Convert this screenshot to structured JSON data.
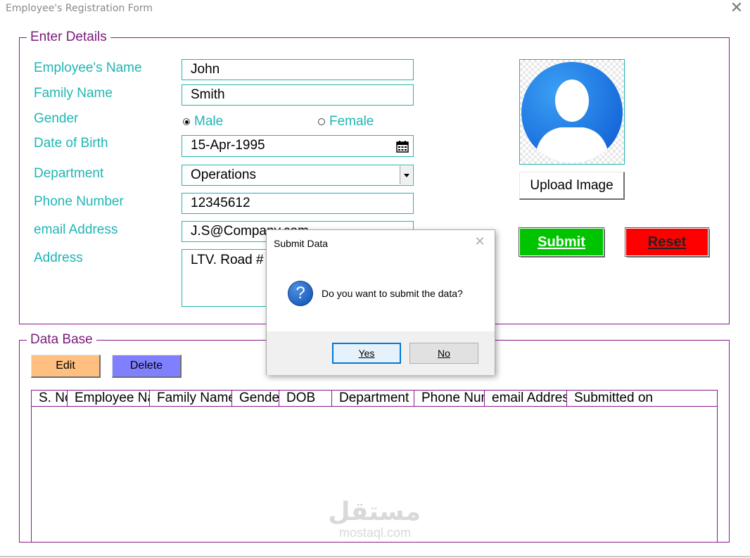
{
  "window": {
    "title": "Employee's Registration Form",
    "close_glyph": "✕"
  },
  "details": {
    "legend": "Enter Details",
    "labels": {
      "name": "Employee's Name",
      "family": "Family Name",
      "gender": "Gender",
      "dob": "Date of Birth",
      "department": "Department",
      "phone": "Phone Number",
      "email": "email Address",
      "address": "Address"
    },
    "values": {
      "name": "John",
      "family": "Smith",
      "dob": "15-Apr-1995",
      "department": "Operations",
      "phone": "12345612",
      "email": "J.S@Company.com",
      "address": "LTV. Road #"
    },
    "gender_options": {
      "male": "Male",
      "female": "Female",
      "selected": "Male"
    },
    "upload_label": "Upload Image",
    "submit_label": "Submit",
    "reset_label": "Reset",
    "colors": {
      "label": "#1fb6b4",
      "border": "#8b1a8b",
      "submit": "#00c000",
      "reset": "#ff0000"
    }
  },
  "database": {
    "legend": "Data Base",
    "edit_label": "Edit",
    "delete_label": "Delete",
    "columns": [
      "S. No",
      "Employee Name",
      "Family Name",
      "Gender",
      "DOB",
      "Department",
      "Phone Number",
      "email Address",
      "Submitted on"
    ],
    "rows": [],
    "colors": {
      "edit": "#ffbf80",
      "delete": "#8080ff"
    }
  },
  "dialog": {
    "title": "Submit Data",
    "message": "Do you want to submit the data?",
    "icon": "question-icon",
    "icon_glyph": "?",
    "yes_label": "Yes",
    "no_label": "No"
  },
  "watermark": {
    "arabic": "مستقل",
    "latin": "mostaql.com"
  }
}
